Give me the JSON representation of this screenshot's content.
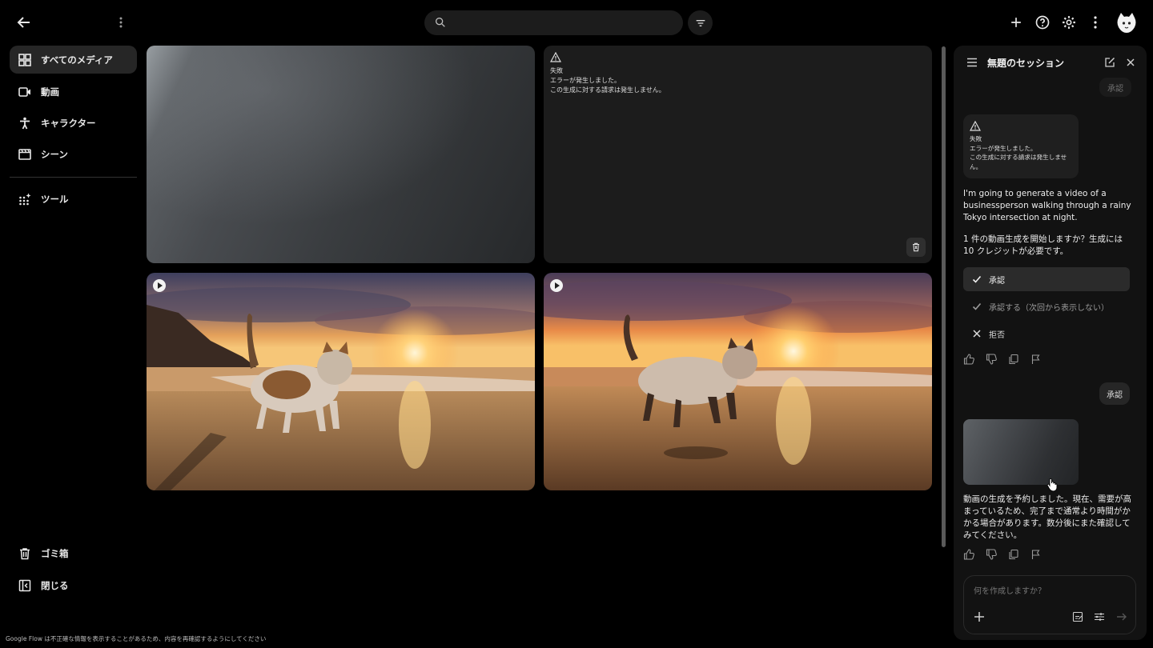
{
  "topbar": {
    "search_placeholder": "",
    "icons": [
      "arrow-back-icon",
      "more-vert-icon",
      "search-icon",
      "filter-icon",
      "plus-icon",
      "help-icon",
      "settings-icon",
      "more-vert-icon",
      "avatar"
    ]
  },
  "sidebar": {
    "items": [
      {
        "label": "すべてのメディア",
        "icon": "grid-icon",
        "active": true
      },
      {
        "label": "動画",
        "icon": "video-icon"
      },
      {
        "label": "キャラクター",
        "icon": "person-icon"
      },
      {
        "label": "シーン",
        "icon": "film-icon"
      },
      {
        "label": "ツール",
        "icon": "apps-sparkle-icon"
      }
    ],
    "bottom": [
      {
        "label": "ゴミ箱",
        "icon": "trash-icon"
      },
      {
        "label": "閉じる",
        "icon": "close-panel-icon"
      }
    ]
  },
  "grid": {
    "error_tile": {
      "title": "失敗",
      "line1": "エラーが発生しました。",
      "line2": "この生成に対する請求は発生しません。"
    }
  },
  "panel": {
    "title": "無題のセッション",
    "prev_approve_label": "承認",
    "error_card": {
      "title": "失敗",
      "line1": "エラーが発生しました。",
      "line2": "この生成に対する請求は発生しませ",
      "line3": "ん。"
    },
    "assistant_msg_1": "I'm going to generate a video of a businessperson walking through a rainy Tokyo intersection at night.",
    "assistant_msg_2": "1 件の動画生成を開始しますか？生成には 10 クレジットが必要です。",
    "options": [
      {
        "label": "承認",
        "icon": "check-icon",
        "selected": true
      },
      {
        "label": "承認する（次回から表示しない）",
        "icon": "check-icon"
      },
      {
        "label": "拒否",
        "icon": "close-icon"
      }
    ],
    "user_reply": "承認",
    "assistant_msg_3": "動画の生成を予約しました。現在、需要が高まっているため、完了まで通常より時間がかかる場合があります。数分後にまた確認してみてください。",
    "composer_placeholder": "何を作成しますか？"
  },
  "footer": {
    "disclaimer": "Google Flow は不正確な情報を表示することがあるため、内容を再確認するようにしてください"
  }
}
